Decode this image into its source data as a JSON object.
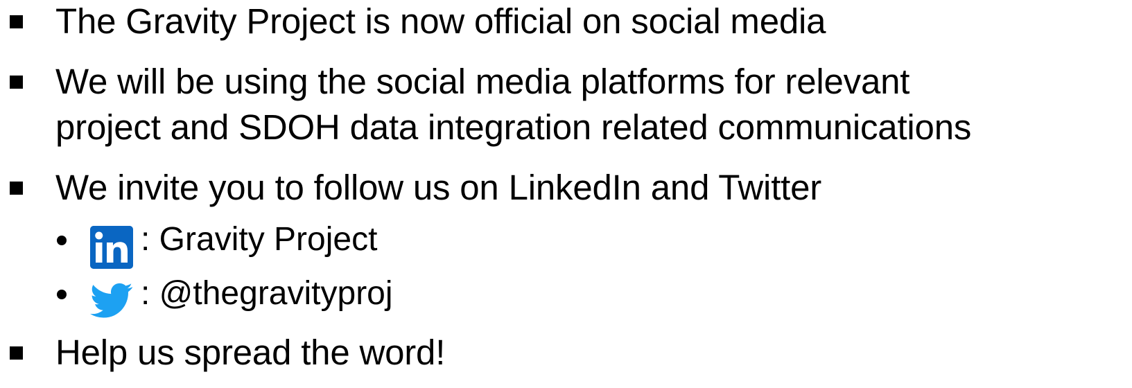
{
  "colors": {
    "linkedin": "#0a66c2",
    "twitter": "#1da1f2",
    "text": "#000000"
  },
  "bullets": [
    {
      "text": "The Gravity Project is now official on social media"
    },
    {
      "lines": [
        "We will be using the social media platforms for relevant",
        "project and SDOH data integration related communications"
      ]
    },
    {
      "text": "We invite you to follow us on LinkedIn and Twitter",
      "sub_items": [
        {
          "icon": "linkedin-icon",
          "text": ": Gravity Project"
        },
        {
          "icon": "twitter-icon",
          "text": ": @thegravityproj"
        }
      ]
    },
    {
      "text": "Help us spread the word!"
    }
  ]
}
